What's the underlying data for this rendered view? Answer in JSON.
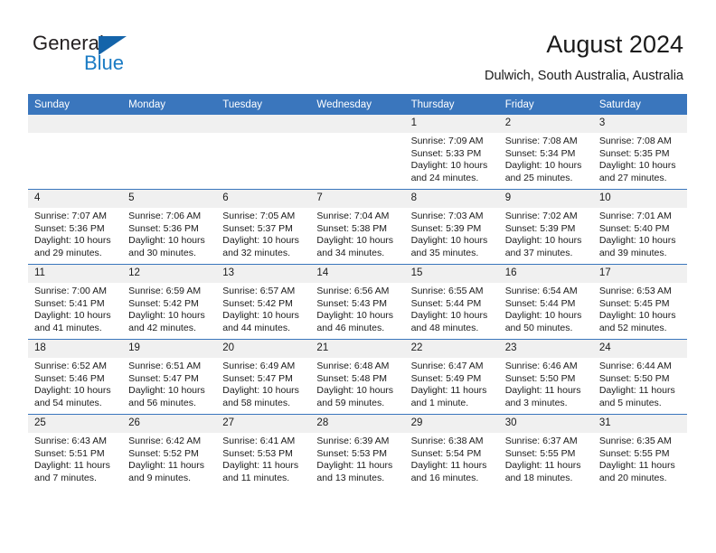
{
  "brand": {
    "name_top": "General",
    "name_bottom": "Blue",
    "triangle_icon": "blue-triangle-logo-mark",
    "color_dark": "#231f20",
    "color_blue": "#1a7bc4"
  },
  "header": {
    "title": "August 2024",
    "subtitle": "Dulwich, South Australia, Australia"
  },
  "theme": {
    "header_row_bg": "#3a76bd",
    "daynum_bg": "#f0f0f0",
    "cell_bg": "#ffffff",
    "text": "#1a1a1a"
  },
  "calendar": {
    "weekday_headers": [
      "Sunday",
      "Monday",
      "Tuesday",
      "Wednesday",
      "Thursday",
      "Friday",
      "Saturday"
    ],
    "weeks": [
      [
        {
          "day": "",
          "empty": true
        },
        {
          "day": "",
          "empty": true
        },
        {
          "day": "",
          "empty": true
        },
        {
          "day": "",
          "empty": true
        },
        {
          "day": "1",
          "sunrise": "Sunrise: 7:09 AM",
          "sunset": "Sunset: 5:33 PM",
          "daylight_line1": "Daylight: 10 hours",
          "daylight_line2": "and 24 minutes."
        },
        {
          "day": "2",
          "sunrise": "Sunrise: 7:08 AM",
          "sunset": "Sunset: 5:34 PM",
          "daylight_line1": "Daylight: 10 hours",
          "daylight_line2": "and 25 minutes."
        },
        {
          "day": "3",
          "sunrise": "Sunrise: 7:08 AM",
          "sunset": "Sunset: 5:35 PM",
          "daylight_line1": "Daylight: 10 hours",
          "daylight_line2": "and 27 minutes."
        }
      ],
      [
        {
          "day": "4",
          "sunrise": "Sunrise: 7:07 AM",
          "sunset": "Sunset: 5:36 PM",
          "daylight_line1": "Daylight: 10 hours",
          "daylight_line2": "and 29 minutes."
        },
        {
          "day": "5",
          "sunrise": "Sunrise: 7:06 AM",
          "sunset": "Sunset: 5:36 PM",
          "daylight_line1": "Daylight: 10 hours",
          "daylight_line2": "and 30 minutes."
        },
        {
          "day": "6",
          "sunrise": "Sunrise: 7:05 AM",
          "sunset": "Sunset: 5:37 PM",
          "daylight_line1": "Daylight: 10 hours",
          "daylight_line2": "and 32 minutes."
        },
        {
          "day": "7",
          "sunrise": "Sunrise: 7:04 AM",
          "sunset": "Sunset: 5:38 PM",
          "daylight_line1": "Daylight: 10 hours",
          "daylight_line2": "and 34 minutes."
        },
        {
          "day": "8",
          "sunrise": "Sunrise: 7:03 AM",
          "sunset": "Sunset: 5:39 PM",
          "daylight_line1": "Daylight: 10 hours",
          "daylight_line2": "and 35 minutes."
        },
        {
          "day": "9",
          "sunrise": "Sunrise: 7:02 AM",
          "sunset": "Sunset: 5:39 PM",
          "daylight_line1": "Daylight: 10 hours",
          "daylight_line2": "and 37 minutes."
        },
        {
          "day": "10",
          "sunrise": "Sunrise: 7:01 AM",
          "sunset": "Sunset: 5:40 PM",
          "daylight_line1": "Daylight: 10 hours",
          "daylight_line2": "and 39 minutes."
        }
      ],
      [
        {
          "day": "11",
          "sunrise": "Sunrise: 7:00 AM",
          "sunset": "Sunset: 5:41 PM",
          "daylight_line1": "Daylight: 10 hours",
          "daylight_line2": "and 41 minutes."
        },
        {
          "day": "12",
          "sunrise": "Sunrise: 6:59 AM",
          "sunset": "Sunset: 5:42 PM",
          "daylight_line1": "Daylight: 10 hours",
          "daylight_line2": "and 42 minutes."
        },
        {
          "day": "13",
          "sunrise": "Sunrise: 6:57 AM",
          "sunset": "Sunset: 5:42 PM",
          "daylight_line1": "Daylight: 10 hours",
          "daylight_line2": "and 44 minutes."
        },
        {
          "day": "14",
          "sunrise": "Sunrise: 6:56 AM",
          "sunset": "Sunset: 5:43 PM",
          "daylight_line1": "Daylight: 10 hours",
          "daylight_line2": "and 46 minutes."
        },
        {
          "day": "15",
          "sunrise": "Sunrise: 6:55 AM",
          "sunset": "Sunset: 5:44 PM",
          "daylight_line1": "Daylight: 10 hours",
          "daylight_line2": "and 48 minutes."
        },
        {
          "day": "16",
          "sunrise": "Sunrise: 6:54 AM",
          "sunset": "Sunset: 5:44 PM",
          "daylight_line1": "Daylight: 10 hours",
          "daylight_line2": "and 50 minutes."
        },
        {
          "day": "17",
          "sunrise": "Sunrise: 6:53 AM",
          "sunset": "Sunset: 5:45 PM",
          "daylight_line1": "Daylight: 10 hours",
          "daylight_line2": "and 52 minutes."
        }
      ],
      [
        {
          "day": "18",
          "sunrise": "Sunrise: 6:52 AM",
          "sunset": "Sunset: 5:46 PM",
          "daylight_line1": "Daylight: 10 hours",
          "daylight_line2": "and 54 minutes."
        },
        {
          "day": "19",
          "sunrise": "Sunrise: 6:51 AM",
          "sunset": "Sunset: 5:47 PM",
          "daylight_line1": "Daylight: 10 hours",
          "daylight_line2": "and 56 minutes."
        },
        {
          "day": "20",
          "sunrise": "Sunrise: 6:49 AM",
          "sunset": "Sunset: 5:47 PM",
          "daylight_line1": "Daylight: 10 hours",
          "daylight_line2": "and 58 minutes."
        },
        {
          "day": "21",
          "sunrise": "Sunrise: 6:48 AM",
          "sunset": "Sunset: 5:48 PM",
          "daylight_line1": "Daylight: 10 hours",
          "daylight_line2": "and 59 minutes."
        },
        {
          "day": "22",
          "sunrise": "Sunrise: 6:47 AM",
          "sunset": "Sunset: 5:49 PM",
          "daylight_line1": "Daylight: 11 hours",
          "daylight_line2": "and 1 minute."
        },
        {
          "day": "23",
          "sunrise": "Sunrise: 6:46 AM",
          "sunset": "Sunset: 5:50 PM",
          "daylight_line1": "Daylight: 11 hours",
          "daylight_line2": "and 3 minutes."
        },
        {
          "day": "24",
          "sunrise": "Sunrise: 6:44 AM",
          "sunset": "Sunset: 5:50 PM",
          "daylight_line1": "Daylight: 11 hours",
          "daylight_line2": "and 5 minutes."
        }
      ],
      [
        {
          "day": "25",
          "sunrise": "Sunrise: 6:43 AM",
          "sunset": "Sunset: 5:51 PM",
          "daylight_line1": "Daylight: 11 hours",
          "daylight_line2": "and 7 minutes."
        },
        {
          "day": "26",
          "sunrise": "Sunrise: 6:42 AM",
          "sunset": "Sunset: 5:52 PM",
          "daylight_line1": "Daylight: 11 hours",
          "daylight_line2": "and 9 minutes."
        },
        {
          "day": "27",
          "sunrise": "Sunrise: 6:41 AM",
          "sunset": "Sunset: 5:53 PM",
          "daylight_line1": "Daylight: 11 hours",
          "daylight_line2": "and 11 minutes."
        },
        {
          "day": "28",
          "sunrise": "Sunrise: 6:39 AM",
          "sunset": "Sunset: 5:53 PM",
          "daylight_line1": "Daylight: 11 hours",
          "daylight_line2": "and 13 minutes."
        },
        {
          "day": "29",
          "sunrise": "Sunrise: 6:38 AM",
          "sunset": "Sunset: 5:54 PM",
          "daylight_line1": "Daylight: 11 hours",
          "daylight_line2": "and 16 minutes."
        },
        {
          "day": "30",
          "sunrise": "Sunrise: 6:37 AM",
          "sunset": "Sunset: 5:55 PM",
          "daylight_line1": "Daylight: 11 hours",
          "daylight_line2": "and 18 minutes."
        },
        {
          "day": "31",
          "sunrise": "Sunrise: 6:35 AM",
          "sunset": "Sunset: 5:55 PM",
          "daylight_line1": "Daylight: 11 hours",
          "daylight_line2": "and 20 minutes."
        }
      ]
    ]
  }
}
